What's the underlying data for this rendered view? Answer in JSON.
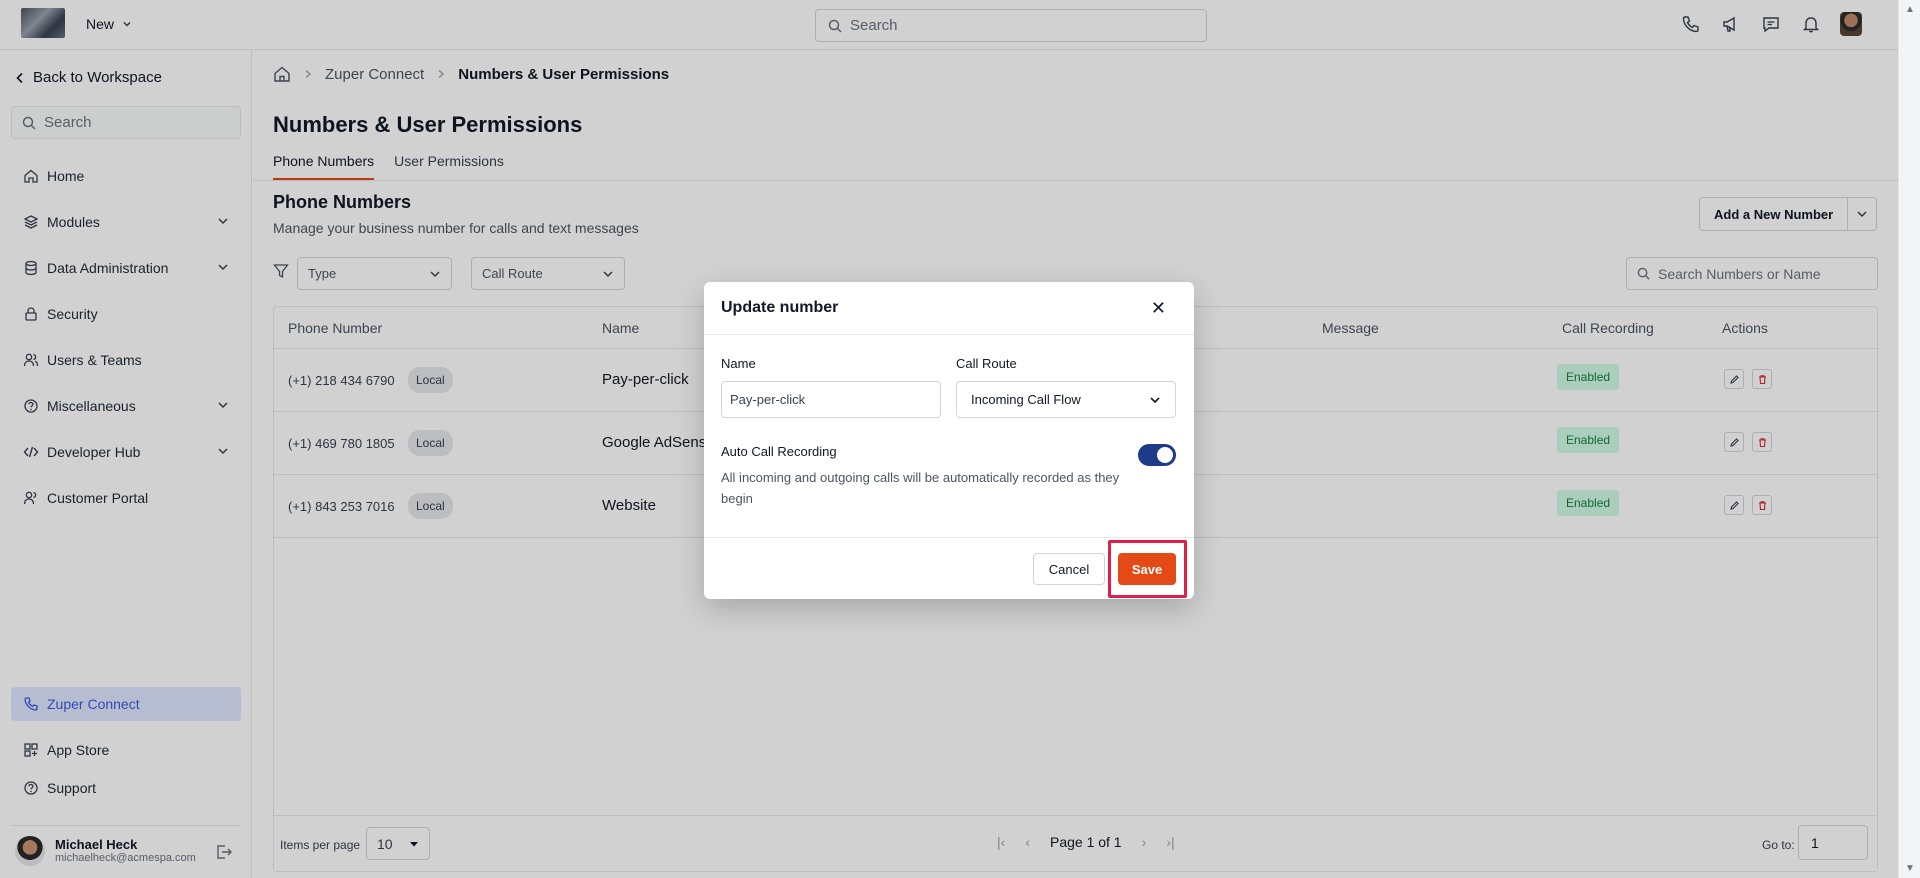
{
  "colors": {
    "accent": "#e44a16",
    "active_nav": "#3b5bdb",
    "toggle": "#1e3a8a",
    "enabled_badge": "#15803d",
    "highlight": "#e11d48"
  },
  "topbar": {
    "new_label": "New",
    "search_placeholder": "Search",
    "icons": [
      "phone-icon",
      "megaphone-icon",
      "chat-icon",
      "bell-icon",
      "avatar"
    ]
  },
  "sidebar": {
    "back_label": "Back to Workspace",
    "search_placeholder": "Search",
    "items": [
      {
        "label": "Home",
        "icon": "home-icon"
      },
      {
        "label": "Modules",
        "icon": "layers-icon"
      },
      {
        "label": "Data Administration",
        "icon": "database-icon"
      },
      {
        "label": "Security",
        "icon": "lock-icon"
      },
      {
        "label": "Users & Teams",
        "icon": "users-icon"
      },
      {
        "label": "Miscellaneous",
        "icon": "help-icon"
      },
      {
        "label": "Developer Hub",
        "icon": "code-icon"
      },
      {
        "label": "Customer Portal",
        "icon": "user-icon"
      }
    ],
    "bottom_items": [
      {
        "label": "Zuper Connect",
        "icon": "phone-icon",
        "active": true
      },
      {
        "label": "App Store",
        "icon": "grid-icon"
      },
      {
        "label": "Support",
        "icon": "help-icon"
      }
    ],
    "user": {
      "name": "Michael Heck",
      "email": "michaelheck@acmespa.com"
    }
  },
  "breadcrumb": {
    "parent": "Zuper Connect",
    "current": "Numbers & User Permissions"
  },
  "page": {
    "title": "Numbers & User Permissions",
    "tabs": [
      "Phone Numbers",
      "User Permissions"
    ],
    "section_title": "Phone Numbers",
    "section_subtitle": "Manage your business number for calls and text messages",
    "add_button": "Add a New Number",
    "filters": {
      "type": "Type",
      "call_route": "Call Route"
    },
    "table_search_placeholder": "Search Numbers or Name"
  },
  "table": {
    "columns": [
      "Phone Number",
      "Name",
      "Message",
      "Call Recording",
      "Actions"
    ],
    "rows": [
      {
        "phone": "(+1) 218 434 6790",
        "badge": "Local",
        "name": "Pay-per-click",
        "recording": "Enabled"
      },
      {
        "phone": "(+1) 469 780 1805",
        "badge": "Local",
        "name": "Google AdSense",
        "recording": "Enabled"
      },
      {
        "phone": "(+1) 843 253 7016",
        "badge": "Local",
        "name": "Website",
        "recording": "Enabled"
      }
    ]
  },
  "pager": {
    "items_per_page_label": "Items per page",
    "items_per_page": "10",
    "page_label": "Page 1 of 1",
    "goto_label": "Go to:",
    "goto_value": "1"
  },
  "modal": {
    "title": "Update number",
    "name_label": "Name",
    "name_value": "Pay-per-click",
    "route_label": "Call Route",
    "route_value": "Incoming Call Flow",
    "recording_label": "Auto Call Recording",
    "recording_on": true,
    "recording_desc": "All incoming and outgoing calls will be automatically recorded as they begin",
    "cancel_label": "Cancel",
    "save_label": "Save"
  }
}
